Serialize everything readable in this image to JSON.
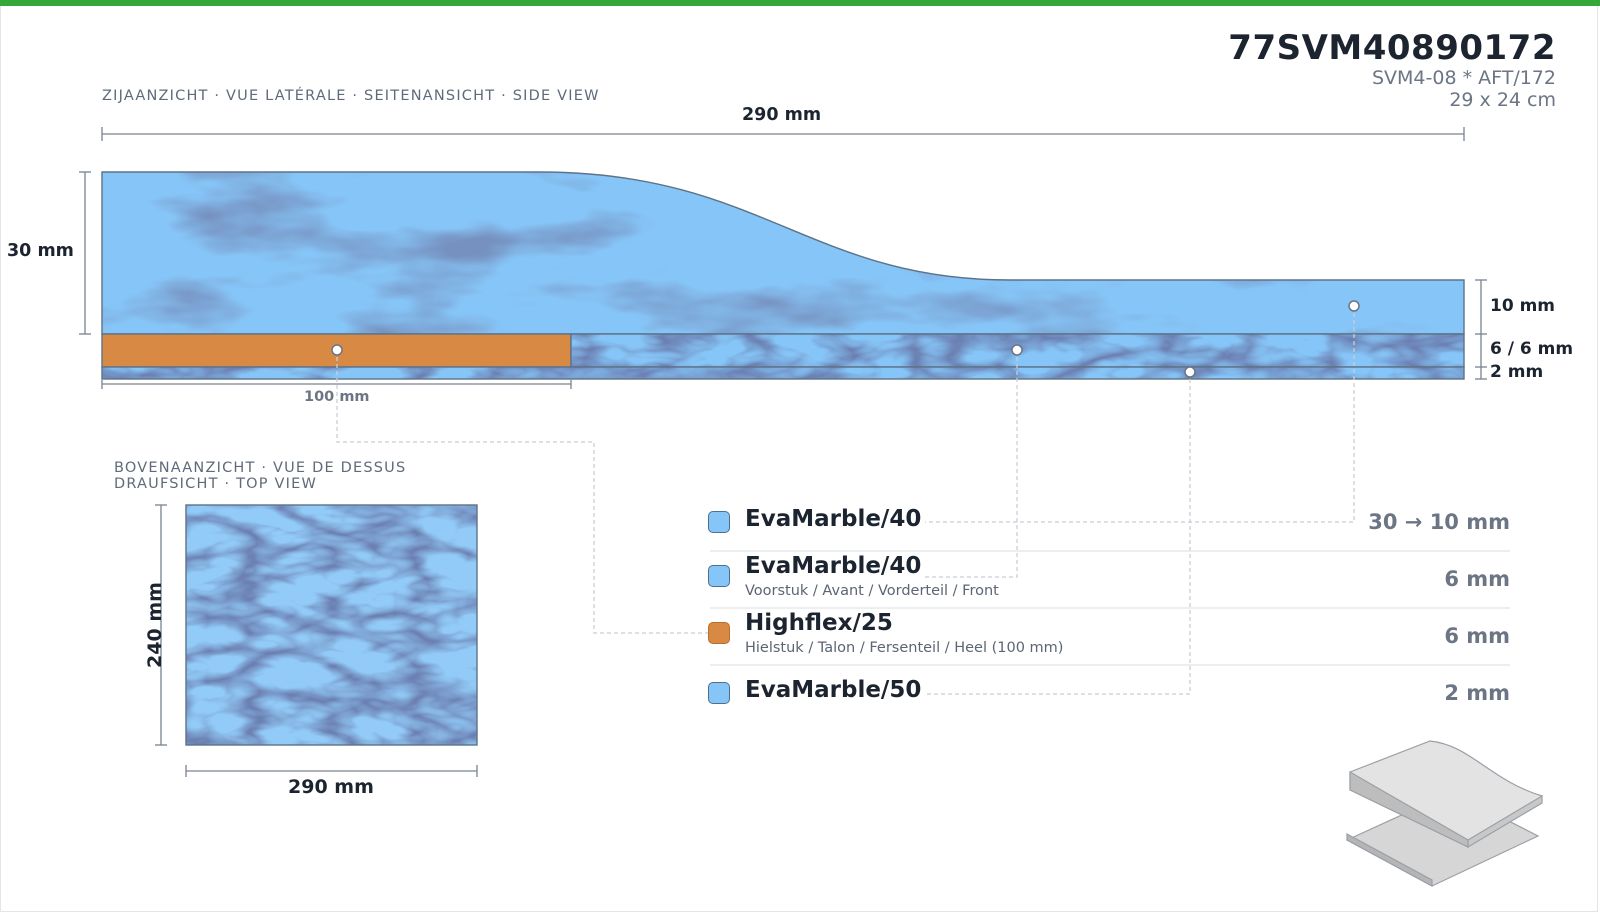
{
  "header": {
    "code": "77SVM40890172",
    "subtitle": "SVM4-08 * AFT/172",
    "size": "29 x 24 cm"
  },
  "side_view": {
    "caption": "ZIJAANZICHT · VUE LATÉRALE · SEITENANSICHT · SIDE VIEW",
    "length_label": "290 mm",
    "height_label": "30 mm",
    "heel_length_label": "100 mm",
    "right_labels": [
      "10 mm",
      "6 / 6 mm",
      "2 mm"
    ]
  },
  "top_view": {
    "caption_line1": "BOVENAANZICHT · VUE DE DESSUS",
    "caption_line2": "DRAUFSICHT · TOP VIEW",
    "width_label": "290 mm",
    "height_label": "240 mm"
  },
  "layers": [
    {
      "name": "EvaMarble/40",
      "detail": "",
      "thickness": "30 → 10 mm",
      "material": "marble"
    },
    {
      "name": "EvaMarble/40",
      "detail": "Voorstuk / Avant / Vorderteil / Front",
      "thickness": "6 mm",
      "material": "marble"
    },
    {
      "name": "Highflex/25",
      "detail": "Hielstuk / Talon / Fersenteil / Heel (100 mm)",
      "thickness": "6 mm",
      "material": "highflex"
    },
    {
      "name": "EvaMarble/50",
      "detail": "",
      "thickness": "2 mm",
      "material": "marble"
    }
  ],
  "colors": {
    "accent_bar": "#35a83a",
    "marble": "#86c5f7",
    "highflex": "#d88a45"
  },
  "icons": [
    "isometric-layers-icon"
  ]
}
